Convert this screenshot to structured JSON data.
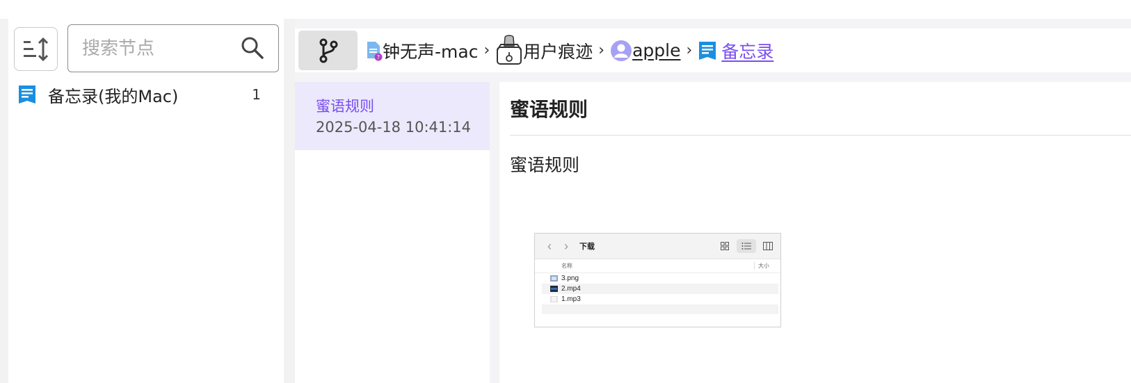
{
  "sidebar": {
    "search_placeholder": "搜索节点",
    "tree": [
      {
        "label": "备忘录(我的Mac)",
        "count": "1"
      }
    ]
  },
  "breadcrumb": {
    "items": [
      {
        "label": "钟无声-mac",
        "icon": "device-file-icon"
      },
      {
        "label": "用户痕迹",
        "icon": "user-trace-icon"
      },
      {
        "label": "apple",
        "icon": "user-avatar-icon"
      },
      {
        "label": "备忘录",
        "icon": "notes-icon"
      }
    ]
  },
  "note_list": [
    {
      "title": "蜜语规则",
      "time": "2025-04-18 10:41:14"
    }
  ],
  "note": {
    "title": "蜜语规则",
    "body": "蜜语规则",
    "attachment": {
      "window_title": "下载",
      "col_name": "名称",
      "col_size": "大小",
      "files": [
        "3.png",
        "2.mp4",
        "1.mp3"
      ]
    }
  },
  "colors": {
    "accent": "#7a4df0",
    "selected_bg": "#ebe9fb",
    "notes_icon": "#1a8fe0"
  }
}
